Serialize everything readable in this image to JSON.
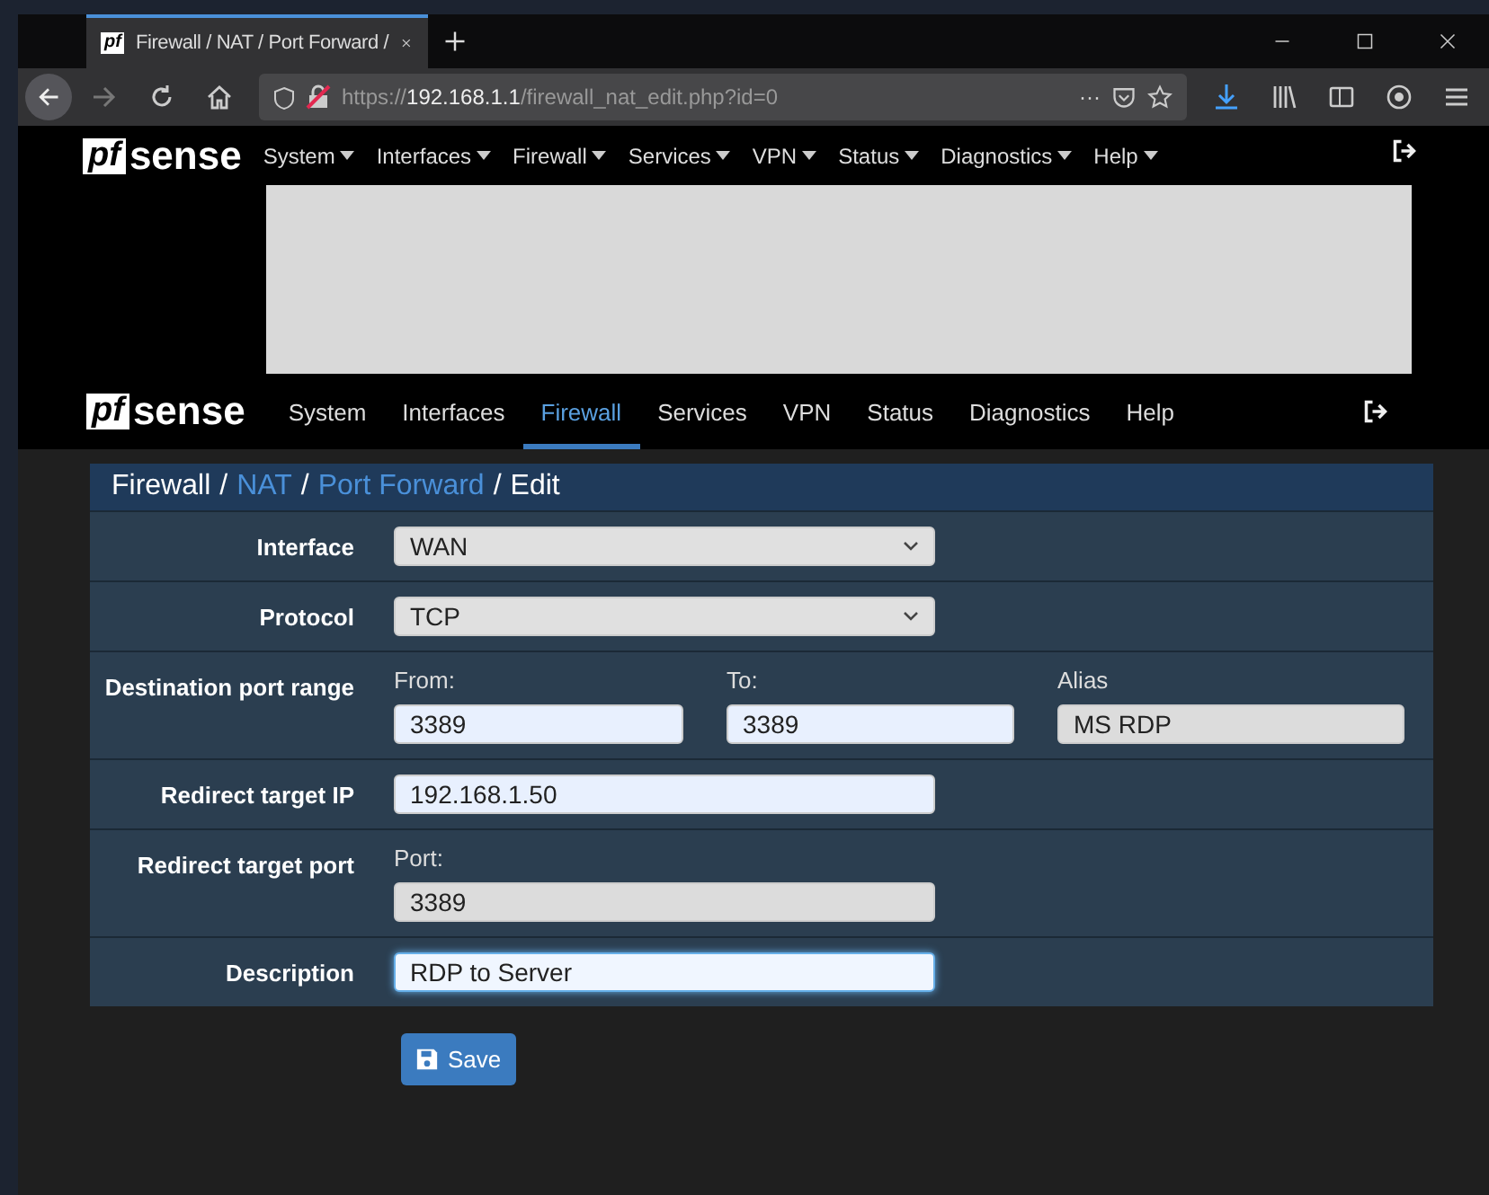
{
  "browser": {
    "tab_title": "Firewall / NAT / Port Forward /",
    "favicon": "pf",
    "url_scheme": "https://",
    "url_host": "192.168.1.1",
    "url_path": "/firewall_nat_edit.php?id=0",
    "page_actions": "···"
  },
  "top_nav": {
    "logo_mark": "pf",
    "logo_word": "sense",
    "items": [
      {
        "label": "System"
      },
      {
        "label": "Interfaces"
      },
      {
        "label": "Firewall"
      },
      {
        "label": "Services"
      },
      {
        "label": "VPN"
      },
      {
        "label": "Status"
      },
      {
        "label": "Diagnostics"
      },
      {
        "label": "Help"
      }
    ]
  },
  "main_nav": {
    "logo_mark": "pf",
    "logo_word": "sense",
    "items": [
      {
        "label": "System",
        "selected": false
      },
      {
        "label": "Interfaces",
        "selected": false
      },
      {
        "label": "Firewall",
        "selected": true
      },
      {
        "label": "Services",
        "selected": false
      },
      {
        "label": "VPN",
        "selected": false
      },
      {
        "label": "Status",
        "selected": false
      },
      {
        "label": "Diagnostics",
        "selected": false
      },
      {
        "label": "Help",
        "selected": false
      }
    ]
  },
  "breadcrumb": [
    {
      "kind": "text",
      "text": "Firewall"
    },
    {
      "kind": "separator",
      "text": "/"
    },
    {
      "kind": "link",
      "text": "NAT"
    },
    {
      "kind": "separator",
      "text": "/"
    },
    {
      "kind": "link",
      "text": "Port Forward"
    },
    {
      "kind": "separator",
      "text": "/"
    },
    {
      "kind": "text",
      "text": "Edit"
    }
  ],
  "form": [
    {
      "kind": "select",
      "label": "Interface",
      "value": "WAN"
    },
    {
      "kind": "select",
      "label": "Protocol",
      "value": "TCP"
    },
    {
      "kind": "range",
      "label": "Destination port range",
      "fields": [
        {
          "caption": "From:",
          "value": "3389",
          "readonly": false
        },
        {
          "caption": "To:",
          "value": "3389",
          "readonly": false
        },
        {
          "caption": "Alias",
          "value": "MS RDP",
          "readonly": true
        }
      ]
    },
    {
      "kind": "text",
      "label": "Redirect target IP",
      "value": "192.168.1.50",
      "readonly": false,
      "focused": false
    },
    {
      "kind": "captioned",
      "label": "Redirect target port",
      "caption": "Port:",
      "value": "3389",
      "readonly": true
    },
    {
      "kind": "text",
      "label": "Description",
      "value": "RDP to Server",
      "readonly": false,
      "focused": true
    }
  ],
  "save_button": "Save"
}
